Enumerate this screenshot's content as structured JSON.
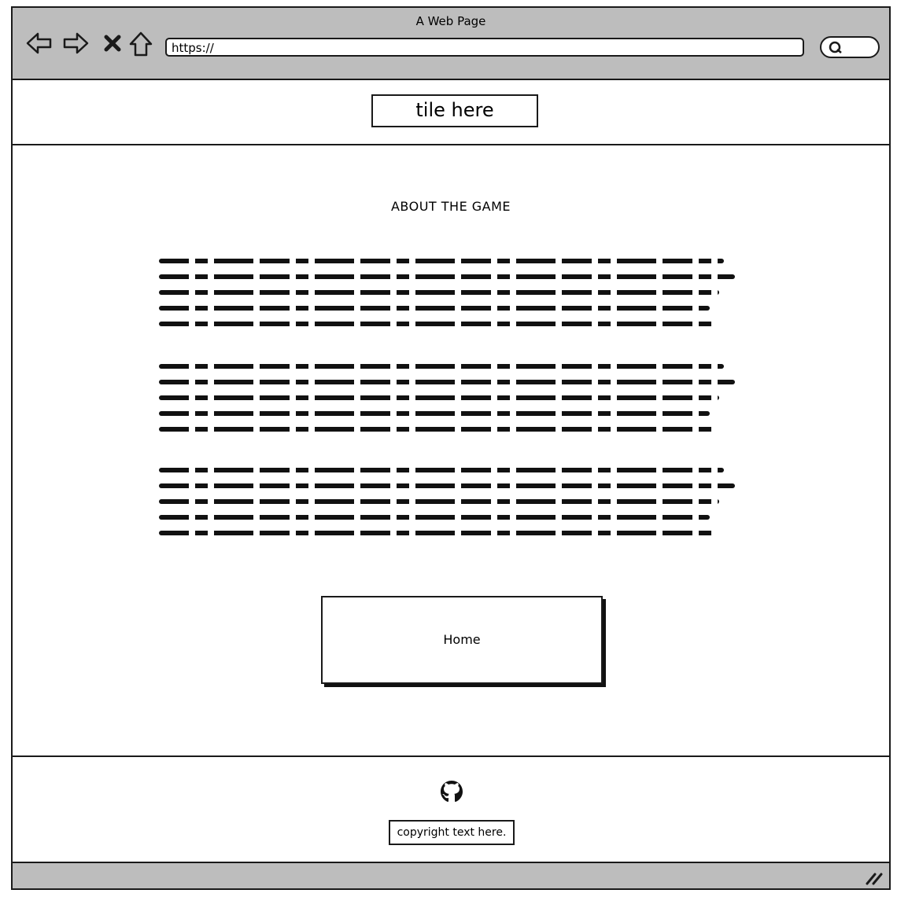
{
  "window": {
    "title": "A Web Page",
    "url": "https://"
  },
  "header": {
    "title": "tile here"
  },
  "main": {
    "heading": "ABOUT THE GAME",
    "paragraph_count": 3,
    "home_button_label": "Home"
  },
  "footer": {
    "icon": "github-icon",
    "copyright": "copyright text here."
  }
}
